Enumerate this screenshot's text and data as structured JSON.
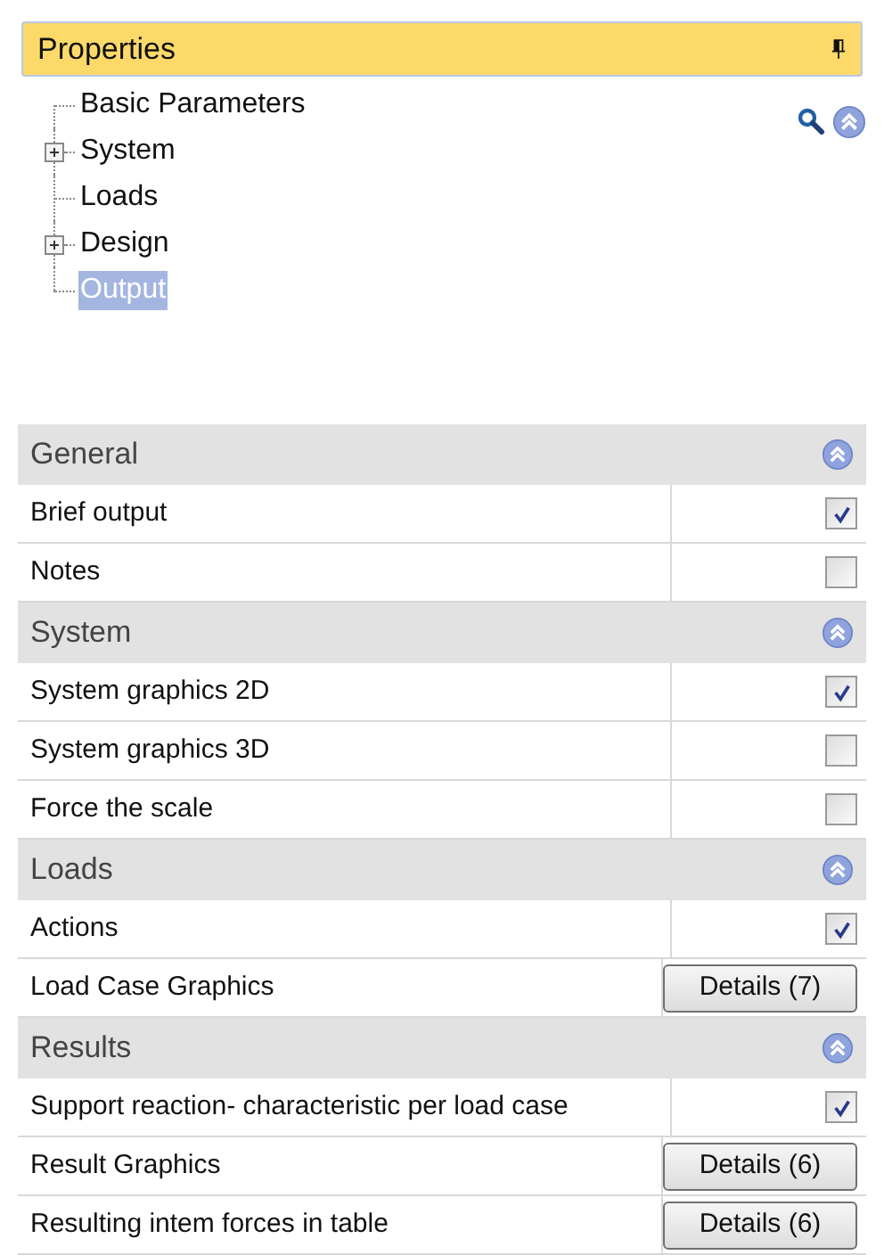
{
  "panel": {
    "title": "Properties"
  },
  "tree": [
    {
      "label": "Basic Parameters",
      "kind": "leaf",
      "selected": false
    },
    {
      "label": "System",
      "kind": "folder",
      "selected": false
    },
    {
      "label": "Loads",
      "kind": "leaf",
      "selected": false
    },
    {
      "label": "Design",
      "kind": "folder",
      "selected": false
    },
    {
      "label": "Output",
      "kind": "leaf",
      "selected": true
    }
  ],
  "sections": [
    {
      "title": "General",
      "rows": [
        {
          "label": "Brief output",
          "kind": "checkbox",
          "checked": true
        },
        {
          "label": "Notes",
          "kind": "checkbox",
          "checked": false
        }
      ]
    },
    {
      "title": "System",
      "rows": [
        {
          "label": "System graphics 2D",
          "kind": "checkbox",
          "checked": true
        },
        {
          "label": "System graphics 3D",
          "kind": "checkbox",
          "checked": false
        },
        {
          "label": "Force the scale",
          "kind": "checkbox",
          "checked": false
        }
      ]
    },
    {
      "title": "Loads",
      "rows": [
        {
          "label": "Actions",
          "kind": "checkbox",
          "checked": true
        },
        {
          "label": "Load Case Graphics",
          "kind": "button",
          "button": "Details (7)"
        }
      ]
    },
    {
      "title": "Results",
      "rows": [
        {
          "label": "Support reaction- characteristic per load case",
          "kind": "checkbox",
          "checked": true
        },
        {
          "label": "Result Graphics",
          "kind": "button",
          "button": "Details (6)"
        },
        {
          "label": "Resulting intem forces in table",
          "kind": "button",
          "button": "Details (6)"
        }
      ]
    }
  ]
}
